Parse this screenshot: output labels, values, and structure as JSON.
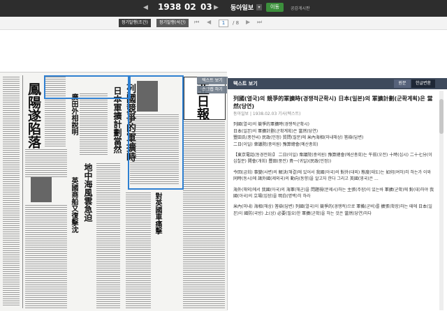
{
  "topbar": {
    "year": "1938",
    "month": "02",
    "day": "03",
    "prev_arrow": "◀",
    "next_arrow": "▶",
    "paper_name": "동아일보",
    "paper_caret": "▾",
    "go_label": "이동",
    "publication_link": "공감게시판"
  },
  "toolbar": {
    "edition1_label": "정기발행(조간)",
    "edition2_label": "정기발행(석간)",
    "first": "⏮",
    "prev": "◀",
    "next": "▶",
    "last": "⏭",
    "current_page": "1",
    "total_pages": "/ 8"
  },
  "overlay_buttons": {
    "text_view": "텍스트 보기",
    "scrap": "스크랩 하기"
  },
  "panel": {
    "title": "텍스트 보기",
    "tab_original": "원문",
    "tab_korean": "한글변환",
    "article_title": "列國(열국)의 競爭的軍擴時(경쟁적군확시) 日本(일본)의 軍擴計劃(군확계획)은 當然(당연)",
    "meta": "동아일보 | 1938.02.03 기사(텍스트)",
    "p1_lines": [
      "列國(열국)의 競爭的軍擴時(경쟁적군확시)",
      "日本(일본)의 軍擴計劃(군확계획)은 當然(당연)",
      "豐田氏(풍전씨) 民政(민정) 質問(질문)에 米內海相(미내해상) 答辯(답변)",
      "二日(이일) 衆議院(중의원) 豫算總會(예산총회)"
    ],
    "p2": "【東京電話(동경전화)】 二日(이일) 衆議院(중의원) 豫算總會(예산총회)는 午前(오전) 十時(십시) 二十七分(이십칠분) 開會(개회) 豐田(풍전) 貴一(귀일)(民政(민정))",
    "p3": "今回(금회) 事變(사변)의 解決(해결)에 있어서 我國(아국)의 對外(대외) 態度(태도)는 如何(여하)히 하는가 이와 同時(동시)에 諸外國(제외국)의 動向(동향)을 알고자 한다 그리고 英國(영국)은 ...",
    "p4": "海外(해외)에서 我國(아국)의 海軍(해군)을 問題視(문제시)하는 主張(주장)이 있는바 軍擴(군확)에 對(대)하야 我國(아국)의 立場(입장)을 明白(명백)히 하라",
    "p5": "米內(미내) 海相(해상) 答辯(답변) 列國(열국)이 競爭的(경쟁적)으로 軍備(군비)를 擴張(확장)하는 때에 日本(일본)이 國防(국방) 上(상) 必要(필요)한 軍擴(군확)을 하는 것은 當然(당연)하다"
  }
}
